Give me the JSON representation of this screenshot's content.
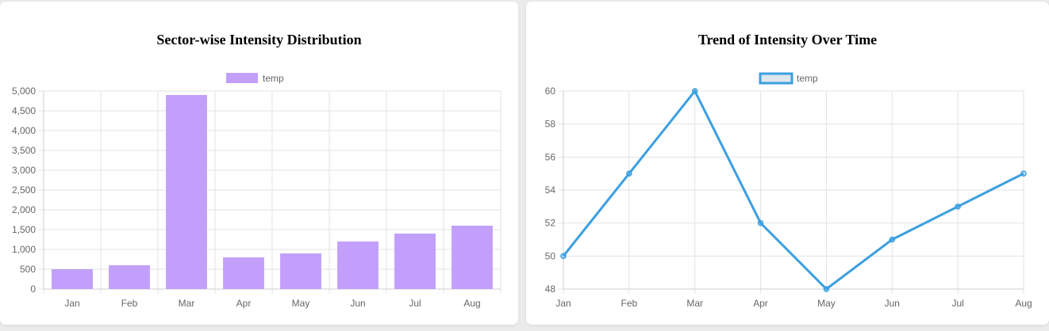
{
  "charts": [
    {
      "title": "Sector-wise Intensity Distribution",
      "chart_data": {
        "type": "bar",
        "categories": [
          "Jan",
          "Feb",
          "Mar",
          "Apr",
          "May",
          "Jun",
          "Jul",
          "Aug"
        ],
        "series": [
          {
            "name": "temp",
            "values": [
              500,
              600,
              4900,
              800,
              900,
              1200,
              1400,
              1600
            ],
            "color": "#c29ffa"
          }
        ],
        "ylim": [
          0,
          5000
        ],
        "yticks": [
          0,
          500,
          1000,
          1500,
          2000,
          2500,
          3000,
          3500,
          4000,
          4500,
          5000
        ],
        "ytick_labels": [
          "0",
          "500",
          "1,000",
          "1,500",
          "2,000",
          "2,500",
          "3,000",
          "3,500",
          "4,000",
          "4,500",
          "5,000"
        ],
        "grid": true,
        "legend_position": "top-center"
      }
    },
    {
      "title": "Trend of Intensity Over Time",
      "chart_data": {
        "type": "line",
        "categories": [
          "Jan",
          "Feb",
          "Mar",
          "Apr",
          "May",
          "Jun",
          "Jul",
          "Aug"
        ],
        "series": [
          {
            "name": "temp",
            "values": [
              50,
              55,
              60,
              52,
              48,
              51,
              53,
              55
            ],
            "color": "#3b9fe0"
          }
        ],
        "ylim": [
          48,
          60
        ],
        "yticks": [
          48,
          50,
          52,
          54,
          56,
          58,
          60
        ],
        "ytick_labels": [
          "48",
          "50",
          "52",
          "54",
          "56",
          "58",
          "60"
        ],
        "grid": true,
        "legend_position": "top-center"
      }
    }
  ]
}
